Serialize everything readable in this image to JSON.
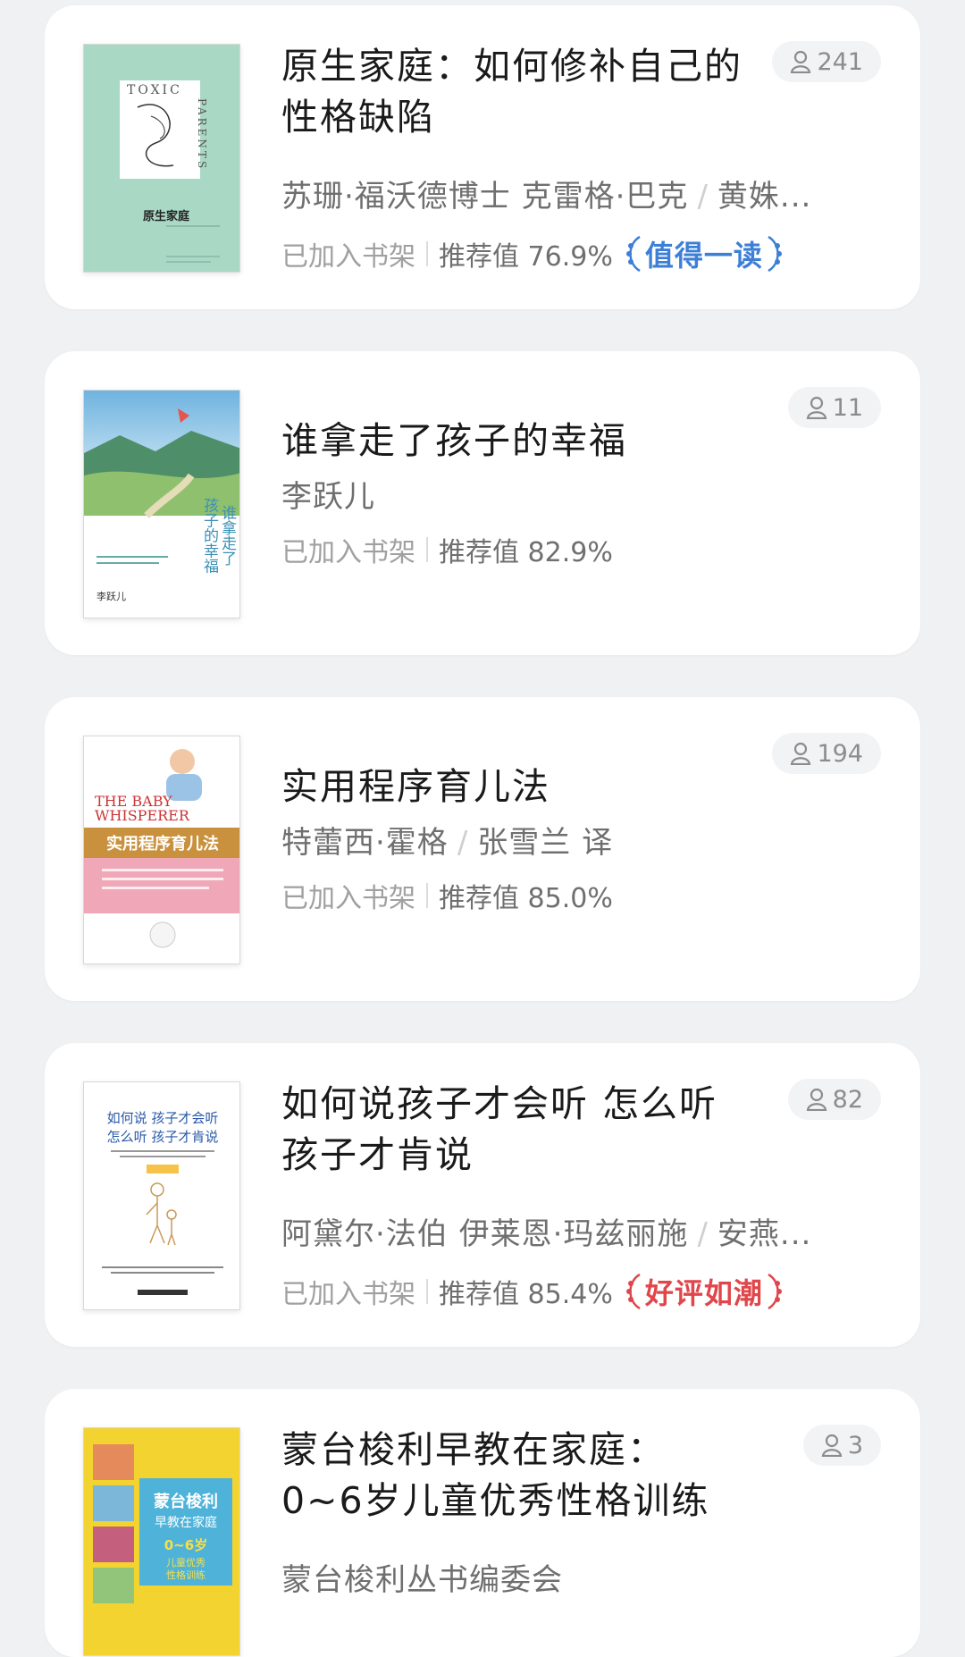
{
  "books": [
    {
      "title": "原生家庭：如何修补自己的性格缺陷",
      "author": "苏珊·福沃德博士 克雷格·巴克",
      "translator": "黄姝...",
      "shelf_label": "已加入书架",
      "recommend": "推荐值 76.9%",
      "badge": "值得一读",
      "badge_color": "#3d7fd6",
      "readers": "241",
      "cover_title": "原生家庭",
      "cover_en": "TOXIC PARENTS",
      "cover_color": "#a9d9c4"
    },
    {
      "title": "谁拿走了孩子的幸福",
      "author": "李跃儿",
      "shelf_label": "已加入书架",
      "recommend": "推荐值 82.9%",
      "readers": "11",
      "cover_title": "谁拿走了孩子的幸福",
      "cover_author": "李跃儿",
      "cover_color": "#d8ecf5"
    },
    {
      "title": "实用程序育儿法",
      "author": "特蕾西·霍格",
      "translator": "张雪兰 译",
      "shelf_label": "已加入书架",
      "recommend": "推荐值 85.0%",
      "readers": "194",
      "cover_title": "实用程序育儿法",
      "cover_en": "THE BABY WHISPERER",
      "cover_color": "#ffffff"
    },
    {
      "title": "如何说孩子才会听 怎么听孩子才肯说",
      "author": "阿黛尔·法伯 伊莱恩·玛兹丽施",
      "translator": "安燕...",
      "shelf_label": "已加入书架",
      "recommend": "推荐值 85.4%",
      "badge": "好评如潮",
      "badge_color": "#e0464b",
      "readers": "82",
      "cover_title_1": "如何说 孩子才会听",
      "cover_title_2": "怎么听 孩子才肯说",
      "cover_color": "#ffffff"
    },
    {
      "title": "蒙台梭利早教在家庭：0~6岁儿童优秀性格训练",
      "author": "蒙台梭利丛书编委会",
      "readers": "3",
      "cover_title": "蒙台梭利早教在家庭",
      "cover_sub": "0~6岁儿童优秀性格训练",
      "cover_color": "#f2d330"
    }
  ]
}
